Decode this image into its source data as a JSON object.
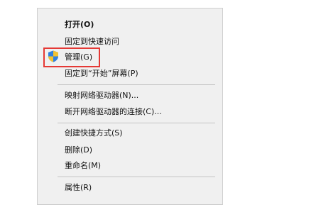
{
  "context_menu": {
    "items": {
      "open": "打开(O)",
      "pin_quick_access": "固定到快速访问",
      "manage": "管理(G)",
      "pin_start": "固定到“开始”屏幕(P)",
      "map_drive": "映射网络驱动器(N)...",
      "disconnect_drive": "断开网络驱动器的连接(C)...",
      "create_shortcut": "创建快捷方式(S)",
      "delete": "删除(D)",
      "rename": "重命名(M)",
      "properties": "属性(R)"
    },
    "manage_icon": "uac-shield-icon",
    "highlight_color": "#e53935"
  }
}
